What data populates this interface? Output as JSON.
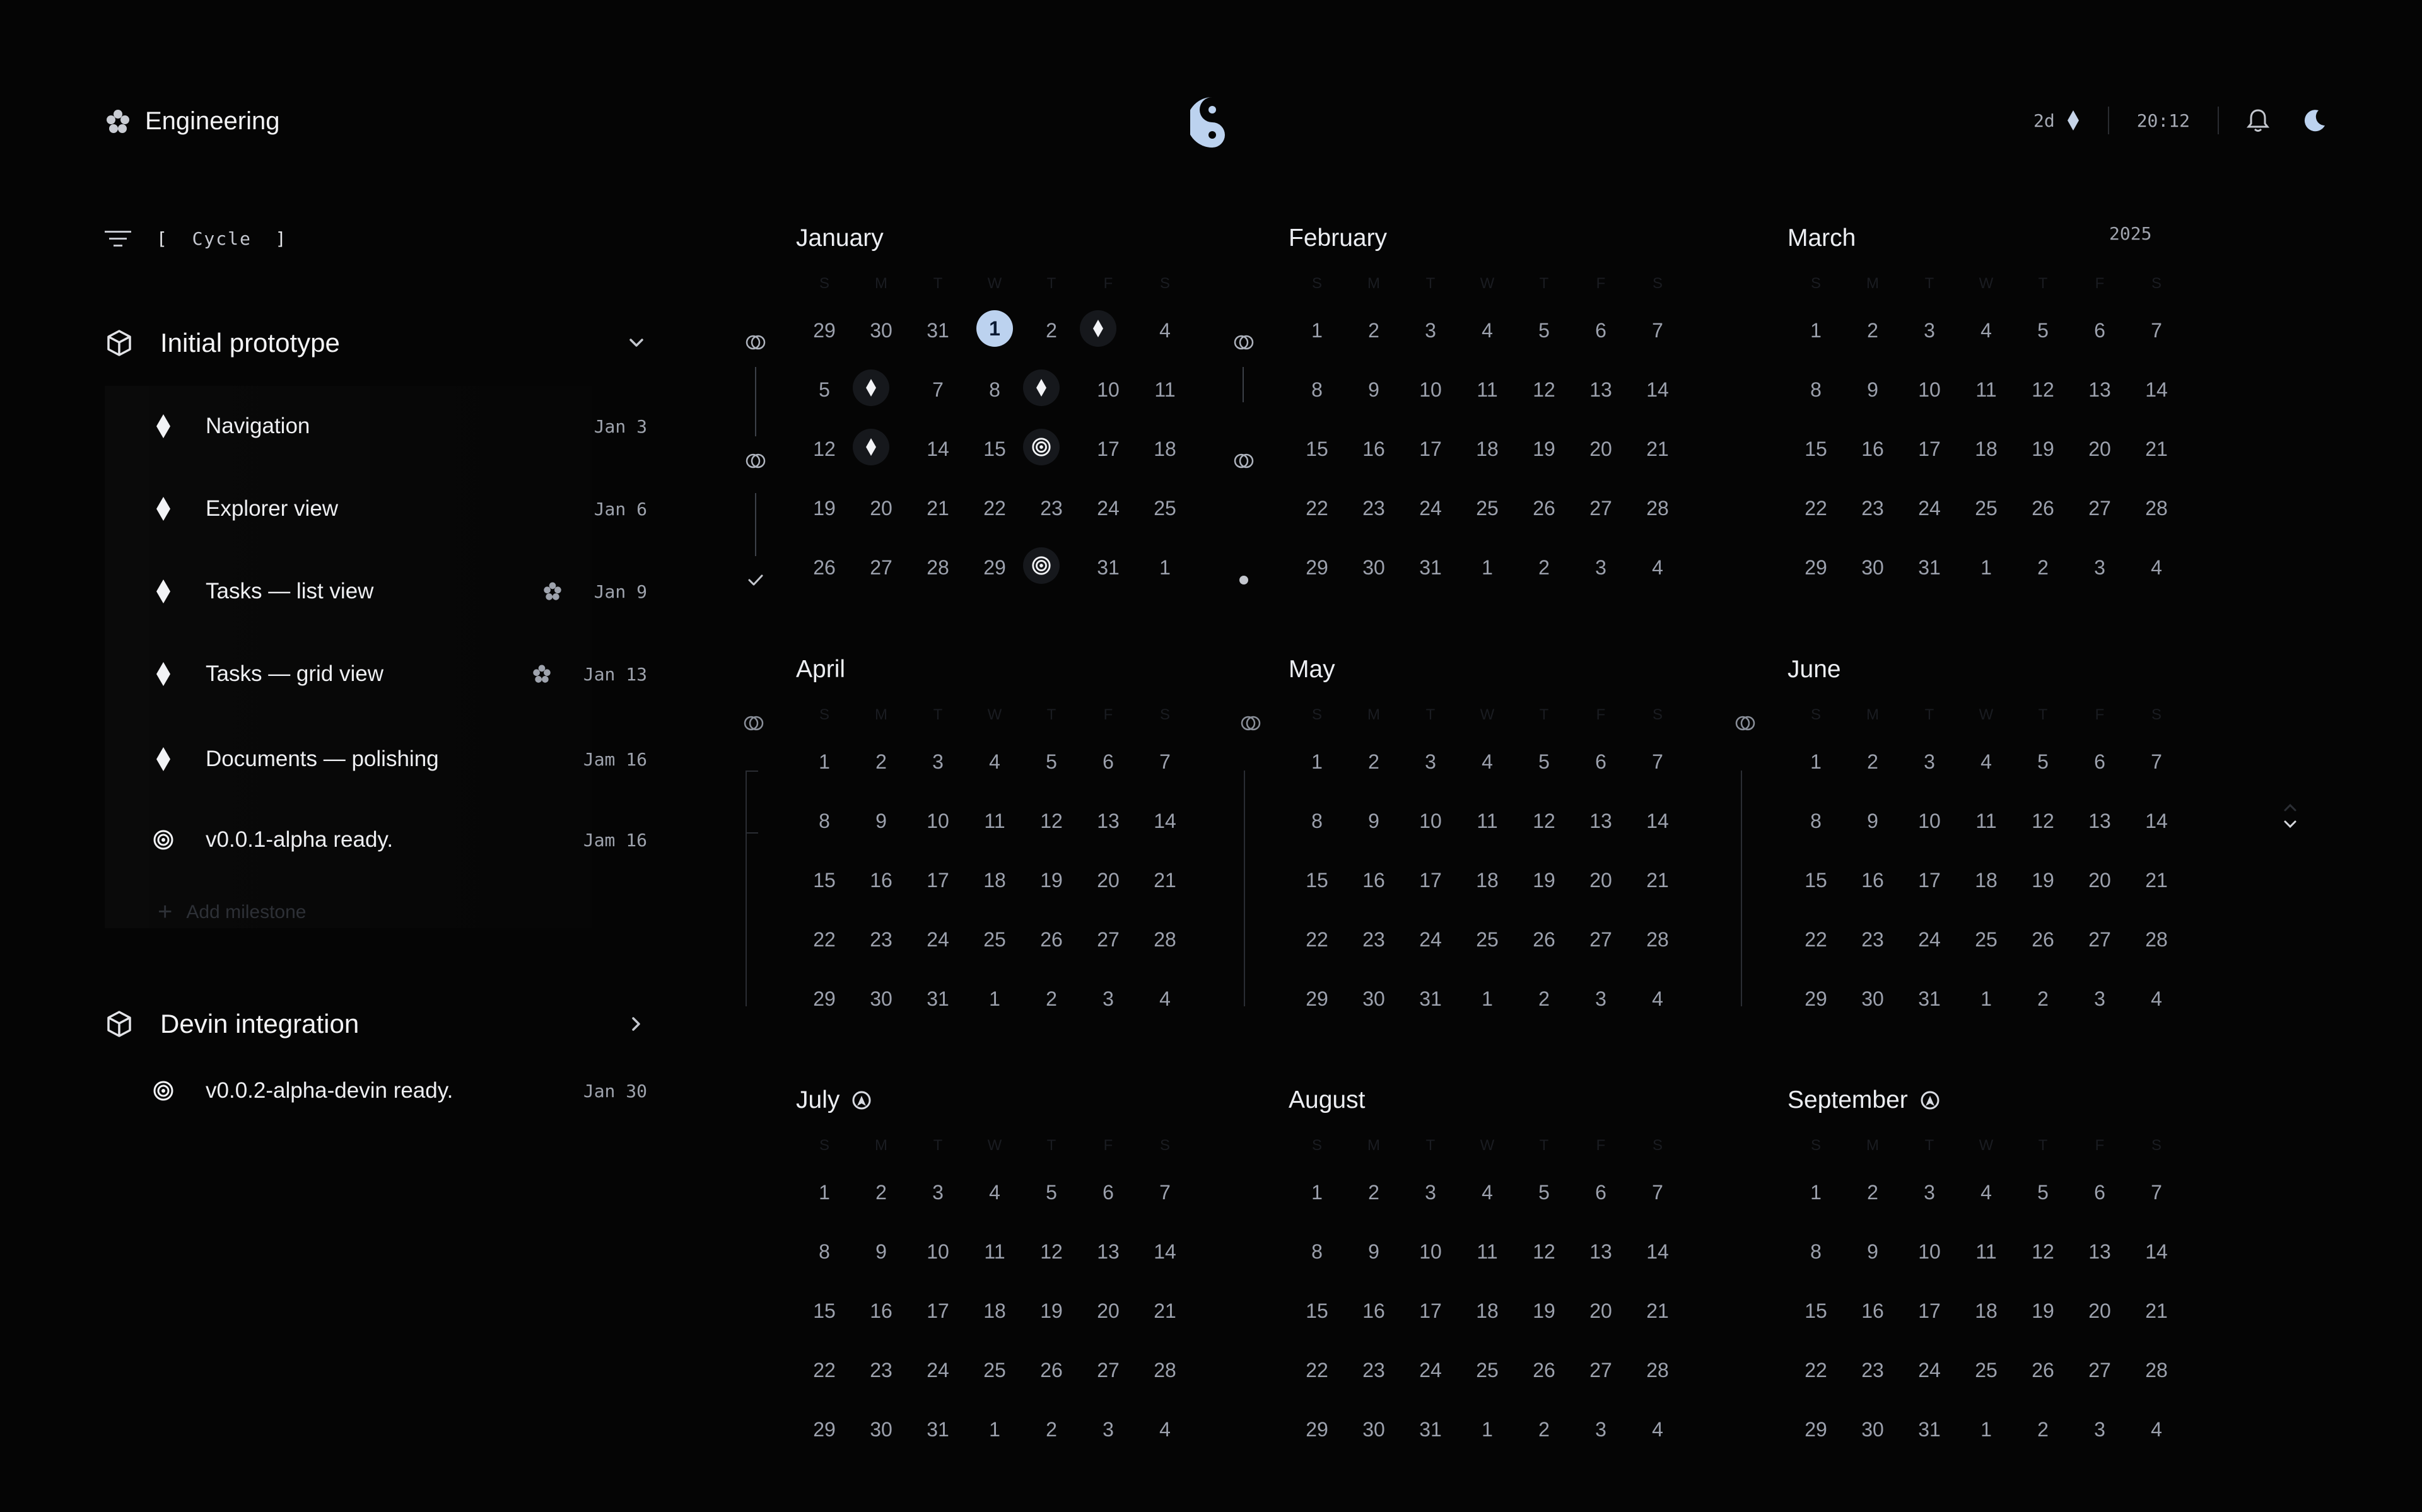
{
  "header": {
    "team_name": "Engineering",
    "team_icon": "flower-icon",
    "logo_icon": "yin-yang-icon",
    "countdown": "2d",
    "time": "20:12"
  },
  "sidebar": {
    "filter_label": "Cycle",
    "projects": [
      {
        "title": "Initial prototype",
        "expanded": true,
        "milestones": [
          {
            "label": "Navigation",
            "date": "Jan 3",
            "icon": "diamond-icon",
            "assignee": false
          },
          {
            "label": "Explorer view",
            "date": "Jan 6",
            "icon": "diamond-icon",
            "assignee": false
          },
          {
            "label": "Tasks — list view",
            "date": "Jan 9",
            "icon": "diamond-icon",
            "assignee": true
          },
          {
            "label": "Tasks — grid view",
            "date": "Jan 13",
            "icon": "diamond-icon",
            "assignee": true
          },
          {
            "label": "Documents — polishing",
            "date": "Jam 16",
            "icon": "diamond-icon",
            "assignee": false
          },
          {
            "label": "v0.0.1-alpha ready.",
            "date": "Jam 16",
            "icon": "target-icon",
            "assignee": false
          }
        ],
        "add_label": "Add milestone"
      },
      {
        "title": "Devin integration",
        "expanded": false,
        "milestones": [
          {
            "label": "v0.0.2-alpha-devin ready.",
            "date": "Jan 30",
            "icon": "target-icon",
            "assignee": false
          }
        ]
      }
    ]
  },
  "calendar": {
    "year": "2025",
    "weekdays": [
      "S",
      "M",
      "T",
      "W",
      "T",
      "F",
      "S"
    ],
    "months": [
      {
        "name": "January",
        "weeks": [
          [
            "29",
            "30",
            "31",
            "1",
            "2",
            "3",
            "4"
          ],
          [
            "5",
            "6",
            "7",
            "8",
            "9",
            "10",
            "11"
          ],
          [
            "12",
            "13",
            "14",
            "15",
            "16",
            "17",
            "18"
          ],
          [
            "19",
            "20",
            "21",
            "22",
            "23",
            "24",
            "25"
          ],
          [
            "26",
            "27",
            "28",
            "29",
            "30",
            "31",
            "1"
          ]
        ]
      },
      {
        "name": "February",
        "weeks": [
          [
            "1",
            "2",
            "3",
            "4",
            "5",
            "6",
            "7"
          ],
          [
            "8",
            "9",
            "10",
            "11",
            "12",
            "13",
            "14"
          ],
          [
            "15",
            "16",
            "17",
            "18",
            "19",
            "20",
            "21"
          ],
          [
            "22",
            "23",
            "24",
            "25",
            "26",
            "27",
            "28"
          ],
          [
            "29",
            "30",
            "31",
            "1",
            "2",
            "3",
            "4"
          ]
        ]
      },
      {
        "name": "March",
        "weeks": [
          [
            "1",
            "2",
            "3",
            "4",
            "5",
            "6",
            "7"
          ],
          [
            "8",
            "9",
            "10",
            "11",
            "12",
            "13",
            "14"
          ],
          [
            "15",
            "16",
            "17",
            "18",
            "19",
            "20",
            "21"
          ],
          [
            "22",
            "23",
            "24",
            "25",
            "26",
            "27",
            "28"
          ],
          [
            "29",
            "30",
            "31",
            "1",
            "2",
            "3",
            "4"
          ]
        ]
      },
      {
        "name": "April",
        "weeks": [
          [
            "1",
            "2",
            "3",
            "4",
            "5",
            "6",
            "7"
          ],
          [
            "8",
            "9",
            "10",
            "11",
            "12",
            "13",
            "14"
          ],
          [
            "15",
            "16",
            "17",
            "18",
            "19",
            "20",
            "21"
          ],
          [
            "22",
            "23",
            "24",
            "25",
            "26",
            "27",
            "28"
          ],
          [
            "29",
            "30",
            "31",
            "1",
            "2",
            "3",
            "4"
          ]
        ]
      },
      {
        "name": "May",
        "weeks": [
          [
            "1",
            "2",
            "3",
            "4",
            "5",
            "6",
            "7"
          ],
          [
            "8",
            "9",
            "10",
            "11",
            "12",
            "13",
            "14"
          ],
          [
            "15",
            "16",
            "17",
            "18",
            "19",
            "20",
            "21"
          ],
          [
            "22",
            "23",
            "24",
            "25",
            "26",
            "27",
            "28"
          ],
          [
            "29",
            "30",
            "31",
            "1",
            "2",
            "3",
            "4"
          ]
        ]
      },
      {
        "name": "June",
        "weeks": [
          [
            "1",
            "2",
            "3",
            "4",
            "5",
            "6",
            "7"
          ],
          [
            "8",
            "9",
            "10",
            "11",
            "12",
            "13",
            "14"
          ],
          [
            "15",
            "16",
            "17",
            "18",
            "19",
            "20",
            "21"
          ],
          [
            "22",
            "23",
            "24",
            "25",
            "26",
            "27",
            "28"
          ],
          [
            "29",
            "30",
            "31",
            "1",
            "2",
            "3",
            "4"
          ]
        ]
      },
      {
        "name": "July",
        "weeks": [
          [
            "1",
            "2",
            "3",
            "4",
            "5",
            "6",
            "7"
          ],
          [
            "8",
            "9",
            "10",
            "11",
            "12",
            "13",
            "14"
          ],
          [
            "15",
            "16",
            "17",
            "18",
            "19",
            "20",
            "21"
          ],
          [
            "22",
            "23",
            "24",
            "25",
            "26",
            "27",
            "28"
          ],
          [
            "29",
            "30",
            "31",
            "1",
            "2",
            "3",
            "4"
          ]
        ]
      },
      {
        "name": "August",
        "weeks": [
          [
            "1",
            "2",
            "3",
            "4",
            "5",
            "6",
            "7"
          ],
          [
            "8",
            "9",
            "10",
            "11",
            "12",
            "13",
            "14"
          ],
          [
            "15",
            "16",
            "17",
            "18",
            "19",
            "20",
            "21"
          ],
          [
            "22",
            "23",
            "24",
            "25",
            "26",
            "27",
            "28"
          ],
          [
            "29",
            "30",
            "31",
            "1",
            "2",
            "3",
            "4"
          ]
        ]
      },
      {
        "name": "September",
        "weeks": [
          [
            "1",
            "2",
            "3",
            "4",
            "5",
            "6",
            "7"
          ],
          [
            "8",
            "9",
            "10",
            "11",
            "12",
            "13",
            "14"
          ],
          [
            "15",
            "16",
            "17",
            "18",
            "19",
            "20",
            "21"
          ],
          [
            "22",
            "23",
            "24",
            "25",
            "26",
            "27",
            "28"
          ],
          [
            "29",
            "30",
            "31",
            "1",
            "2",
            "3",
            "4"
          ]
        ]
      }
    ],
    "january_markers": {
      "today": "1",
      "milestone_days": [
        "3",
        "6",
        "9",
        "13"
      ],
      "target_days": [
        "16",
        "30"
      ]
    },
    "colors": {
      "today_bg": "#bcd2ef",
      "background": "#050505",
      "text": "#9ca1ad"
    }
  }
}
